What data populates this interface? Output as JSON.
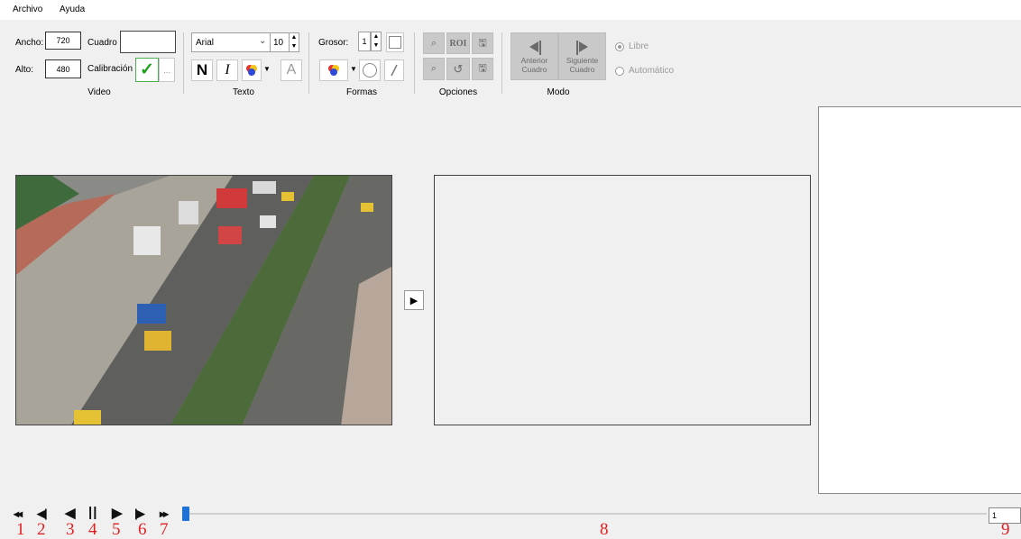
{
  "menu": {
    "archivo": "Archivo",
    "ayuda": "Ayuda"
  },
  "video": {
    "ancho_label": "Ancho:",
    "ancho_value": "720",
    "alto_label": "Alto:",
    "alto_value": "480",
    "cuadro_label": "Cuadro",
    "cuadro_value": "",
    "calibracion_label": "Calibración",
    "check_glyph": "✓",
    "more_glyph": "...",
    "group_label": "Video"
  },
  "texto": {
    "font_value": "Arial",
    "size_value": "10",
    "bold_glyph": "N",
    "italic_glyph": "I",
    "clear_glyph": "A",
    "group_label": "Texto"
  },
  "formas": {
    "grosor_label": "Grosor:",
    "grosor_value": "1",
    "group_label": "Formas"
  },
  "opciones": {
    "roi_label": "ROI",
    "group_label": "Opciones"
  },
  "modo": {
    "anterior_label": "Anterior Cuadro",
    "siguiente_label": "Siguiente Cuadro",
    "group_label": "Modo",
    "libre_label": "Libre",
    "automatico_label": "Automático"
  },
  "playback": {
    "first_glyph": "◂◂",
    "prev_frame_glyph": "◀|",
    "play_back_glyph": "◀",
    "pause_glyph": "||",
    "play_glyph": "▶",
    "next_frame_glyph": "|▶",
    "last_glyph": "▸▸",
    "frame_value": "1",
    "play_arrow_glyph": "▶"
  },
  "annotations": [
    "1",
    "2",
    "3",
    "4",
    "5",
    "6",
    "7",
    "8",
    "9"
  ],
  "colors": {
    "accent": "#1f73d6",
    "annotation": "#e02020",
    "check": "#1aa01a"
  }
}
